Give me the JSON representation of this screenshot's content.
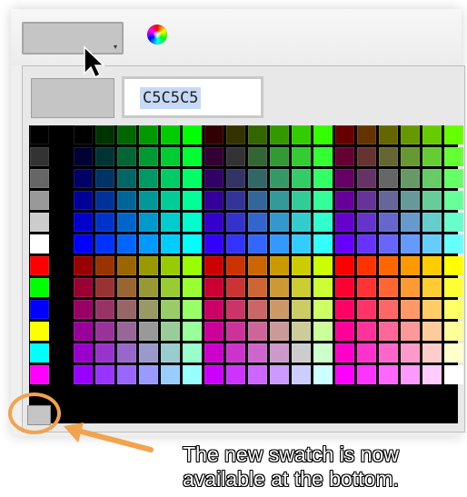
{
  "color_panel": {
    "color_well_value": "#C5C5C5",
    "hex_value": "C5C5C5"
  },
  "icons": {
    "color_wheel": "color-wheel-icon",
    "cursor": "mouse-pointer-icon",
    "dropdown": "dropdown-caret-icon"
  },
  "colors": {
    "accent": "#f2a34d",
    "selection": "#c6d9f7",
    "background": "#efefef",
    "swatch_gray": "#c5c5c5"
  },
  "palette": {
    "grayscale": [
      "#000000",
      "#333333",
      "#666666",
      "#999999",
      "#cccccc",
      "#ffffff"
    ],
    "primaries": [
      "#ff0000",
      "#00ff00",
      "#0000ff",
      "#ffff00",
      "#00ffff",
      "#ff00ff"
    ],
    "custom_swatches": [
      "#c5c5c5"
    ]
  },
  "annotation": {
    "callout_line1": "The new swatch is now",
    "callout_line2": "available at the bottom."
  }
}
